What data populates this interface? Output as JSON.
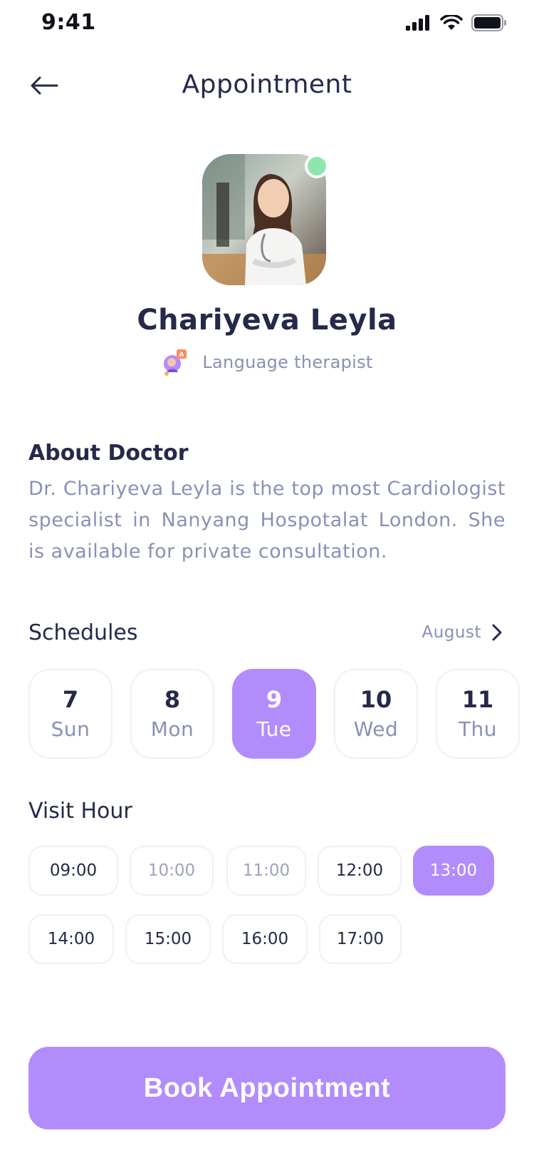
{
  "status": {
    "time": "9:41"
  },
  "header": {
    "title": "Appointment"
  },
  "doctor": {
    "name": "Chariyeva Leyla",
    "specialty": "Language therapist",
    "online": true
  },
  "about": {
    "title": "About Doctor",
    "text": "Dr. Chariyeva Leyla is the top most Cardiologist specialist in Nanyang Hospotalat London. She is available for private consultation."
  },
  "schedules": {
    "title": "Schedules",
    "month": "August",
    "days": [
      {
        "num": "7",
        "name": "Sun",
        "selected": false
      },
      {
        "num": "8",
        "name": "Mon",
        "selected": false
      },
      {
        "num": "9",
        "name": "Tue",
        "selected": true
      },
      {
        "num": "10",
        "name": "Wed",
        "selected": false
      },
      {
        "num": "11",
        "name": "Thu",
        "selected": false
      }
    ]
  },
  "visit": {
    "title": "Visit Hour",
    "hours": [
      {
        "label": "09:00",
        "state": "available"
      },
      {
        "label": "10:00",
        "state": "disabled"
      },
      {
        "label": "11:00",
        "state": "disabled"
      },
      {
        "label": "12:00",
        "state": "available"
      },
      {
        "label": "13:00",
        "state": "selected"
      },
      {
        "label": "14:00",
        "state": "available"
      },
      {
        "label": "15:00",
        "state": "available"
      },
      {
        "label": "16:00",
        "state": "available"
      },
      {
        "label": "17:00",
        "state": "available"
      }
    ]
  },
  "cta": {
    "label": "Book Appointment"
  },
  "colors": {
    "accent": "#b38cfc",
    "text": "#25294a",
    "muted": "#8a90b6",
    "online": "#8ee6ad"
  }
}
